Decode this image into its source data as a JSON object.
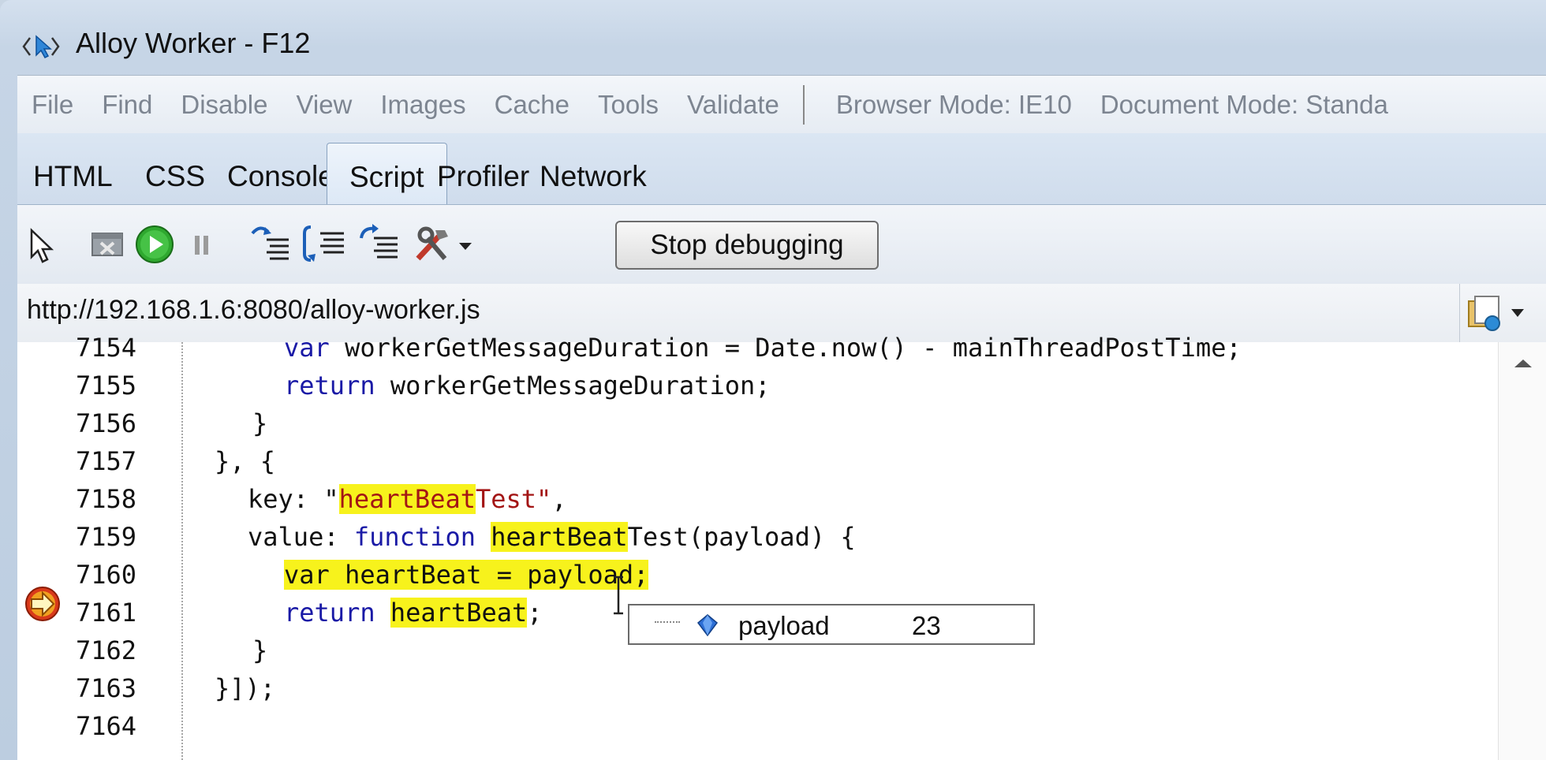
{
  "window": {
    "title": "Alloy Worker - F12"
  },
  "menubar": {
    "items": [
      "File",
      "Find",
      "Disable",
      "View",
      "Images",
      "Cache",
      "Tools",
      "Validate"
    ],
    "browser_mode": "Browser Mode: IE10",
    "document_mode": "Document Mode: Standa"
  },
  "tabs": [
    {
      "label": "HTML"
    },
    {
      "label": "CSS"
    },
    {
      "label": "Console"
    },
    {
      "label": "Script",
      "active": true
    },
    {
      "label": "Profiler"
    },
    {
      "label": "Network"
    }
  ],
  "toolbar": {
    "icons": [
      "select-element-icon",
      "break-on-error-icon",
      "continue-icon",
      "pause-icon",
      "step-into-icon",
      "step-over-icon",
      "step-out-icon",
      "tools-icon"
    ],
    "stop_label": "Stop debugging"
  },
  "url": {
    "value": "http://192.168.1.6:8080/alloy-worker.js"
  },
  "code": {
    "lines": [
      {
        "no": "7154"
      },
      {
        "no": "7155"
      },
      {
        "no": "7156"
      },
      {
        "no": "7157"
      },
      {
        "no": "7158"
      },
      {
        "no": "7159"
      },
      {
        "no": "7160",
        "current": true
      },
      {
        "no": "7161"
      },
      {
        "no": "7162"
      },
      {
        "no": "7163"
      },
      {
        "no": "7164"
      }
    ],
    "tokens": {
      "l7154_kw": "var",
      "l7154_rest": " workerGetMessageDuration = Date.now() - mainThreadPostTime;",
      "l7155_kw": "return",
      "l7155_rest": " workerGetMessageDuration;",
      "l7156": "}",
      "l7157": "}, {",
      "l7158_a": "key: \"",
      "l7158_hl": "heartBeat",
      "l7158_b": "Test\"",
      "l7158_c": ",",
      "l7159_a": "value: ",
      "l7159_kw": "function",
      "l7159_sp": " ",
      "l7159_hl": "heartBeat",
      "l7159_rest": "Test(payload) {",
      "l7160": "var heartBeat = payload;",
      "l7161_kw": "return",
      "l7161_sp": " ",
      "l7161_hl": "heartBeat",
      "l7161_rest": ";",
      "l7162": "}",
      "l7163": "}]);"
    }
  },
  "datatip": {
    "name": "payload",
    "value": "23"
  },
  "colors": {
    "keyword": "#1a1aa6",
    "string": "#a31515",
    "highlight": "#f7f21c",
    "breakpoint": "#d93a1a"
  }
}
